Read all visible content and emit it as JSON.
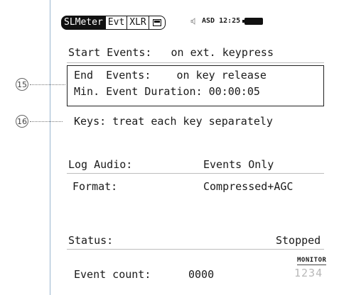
{
  "tabs": [
    {
      "label": "SLMeter",
      "active": true
    },
    {
      "label": "Evt",
      "active": false
    },
    {
      "label": "XLR",
      "active": false
    }
  ],
  "status": {
    "source": "ASD",
    "time": "12:25"
  },
  "settings": {
    "start_events": "Start Events:   on ext. keypress",
    "end_events": "End  Events:    on key release",
    "min_duration": "Min. Event Duration: 00:00:05",
    "keys": "Keys: treat each key separately",
    "log_audio_label": "Log Audio:",
    "log_audio_value": "Events Only",
    "format_label": "Format:",
    "format_value": "Compressed+AGC"
  },
  "state": {
    "status_label": "Status:",
    "status_value": "Stopped",
    "event_count_label": "Event count:",
    "event_count_value": "0000",
    "monitor_label": "MONITOR",
    "channels": "1234"
  },
  "callouts": {
    "first": "15",
    "second": "16"
  },
  "colors": {
    "lcd_border": "#9bb6cf",
    "text": "#1a1a1a",
    "dim": "#b8b8b8"
  }
}
